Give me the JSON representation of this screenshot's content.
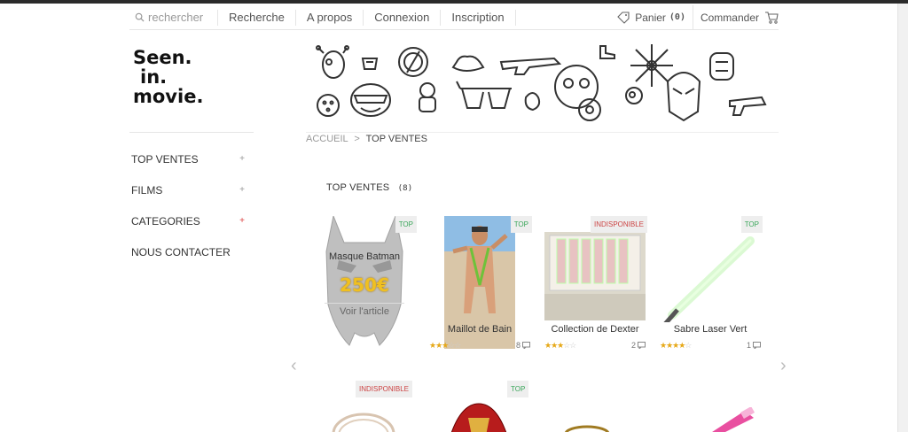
{
  "nav": {
    "search_placeholder": "rechercher",
    "links": [
      "Recherche",
      "A propos",
      "Connexion",
      "Inscription"
    ],
    "cart_label": "Panier",
    "cart_count": "(0)",
    "order_label": "Commander"
  },
  "logo": {
    "line1": "Seen.",
    "line2": "in.",
    "line3": "movie."
  },
  "sidebar": {
    "items": [
      {
        "label": "TOP VENTES",
        "plus": "+"
      },
      {
        "label": "FILMS",
        "plus": "+"
      },
      {
        "label": "CATEGORIES",
        "plus": "+"
      },
      {
        "label": "NOUS CONTACTER",
        "plus": ""
      }
    ]
  },
  "breadcrumb": {
    "home": "ACCUEIL",
    "sep": ">",
    "current": "TOP VENTES"
  },
  "section": {
    "title": "TOP VENTES",
    "count": "(8)"
  },
  "products": [
    {
      "name": "Masque Batman",
      "badge": "TOP",
      "price": "250€",
      "link": "Voir l'article",
      "rating": 0,
      "reviews": ""
    },
    {
      "name": "Maillot de Bain",
      "badge": "TOP",
      "rating": 2.5,
      "reviews": "8"
    },
    {
      "name": "Collection de Dexter",
      "badge": "INDISPONIBLE",
      "rating": 2.5,
      "reviews": "2"
    },
    {
      "name": "Sabre Laser Vert",
      "badge": "TOP",
      "rating": 4,
      "reviews": "1"
    }
  ],
  "second_row_badges": [
    "INDISPONIBLE",
    "TOP"
  ],
  "colors": {
    "top_badge": "#3aa65a",
    "indispo_badge": "#cc4444",
    "star": "#e6a817"
  }
}
